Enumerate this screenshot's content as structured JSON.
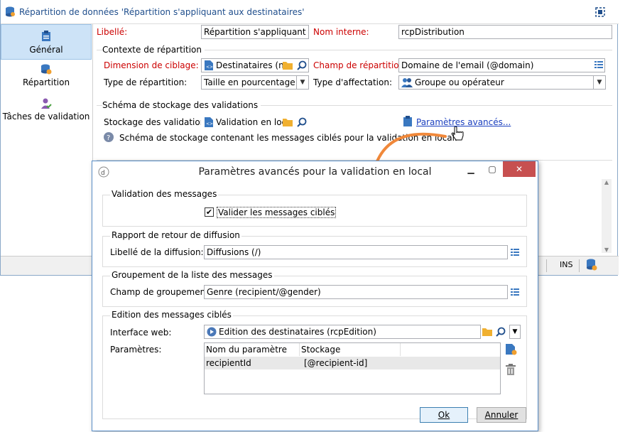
{
  "main": {
    "title": "Répartition de données 'Répartition s'appliquant aux destinataires'",
    "sidebar": [
      {
        "label": "Général",
        "icon": "clipboard-icon"
      },
      {
        "label": "Répartition",
        "icon": "database-user-icon"
      },
      {
        "label": "Tâches de validation",
        "icon": "user-check-icon"
      }
    ],
    "libelle_label": "Libellé:",
    "libelle_value": "Répartition s'appliquant aux",
    "nom_interne_label": "Nom interne:",
    "nom_interne_value": "rcpDistribution",
    "contexte_title": "Contexte de répartition",
    "dimension_label": "Dimension de ciblage:",
    "dimension_value": "Destinataires (nm",
    "champ_rep_label": "Champ de répartition:",
    "champ_rep_value": "Domaine de l'email (@domain)",
    "type_rep_label": "Type de répartition:",
    "type_rep_value": "Taille en pourcentage",
    "type_aff_label": "Type d'affectation:",
    "type_aff_value": "Groupe ou opérateur",
    "schema_title": "Schéma de stockage des validations",
    "stockage_label": "Stockage des validations:",
    "stockage_value": "Validation en loca",
    "params_link": "Paramètres avancés...",
    "info_text": "Schéma de stockage contenant les messages ciblés pour la validation en local.",
    "status_ins": "INS"
  },
  "dialog": {
    "title": "Paramètres avancés pour la validation en local",
    "validation_title": "Validation des messages",
    "valider_label": "Valider les messages ciblés",
    "valider_checked": true,
    "rapport_title": "Rapport de retour de diffusion",
    "libelle_diff_label": "Libellé de la diffusion:",
    "libelle_diff_value": "Diffusions (/)",
    "groupement_title": "Groupement de la liste des messages",
    "champ_grp_label": "Champ de groupement:",
    "champ_grp_value": "Genre (recipient/@gender)",
    "edition_title": "Edition des messages ciblés",
    "interface_label": "Interface web:",
    "interface_value": "Edition des destinataires (rcpEdition)",
    "parametres_label": "Paramètres:",
    "table": {
      "headers": [
        "Nom du paramètre",
        "Stockage"
      ],
      "rows": [
        [
          "recipientId",
          "[@recipient-id]"
        ]
      ]
    },
    "ok_label": "Ok",
    "annuler_label": "Annuler"
  },
  "colors": {
    "accent": "#1f4e8c",
    "selection": "#cde3f7",
    "close": "#c75050",
    "arrow": "#f0883a",
    "required": "#cc0000"
  }
}
